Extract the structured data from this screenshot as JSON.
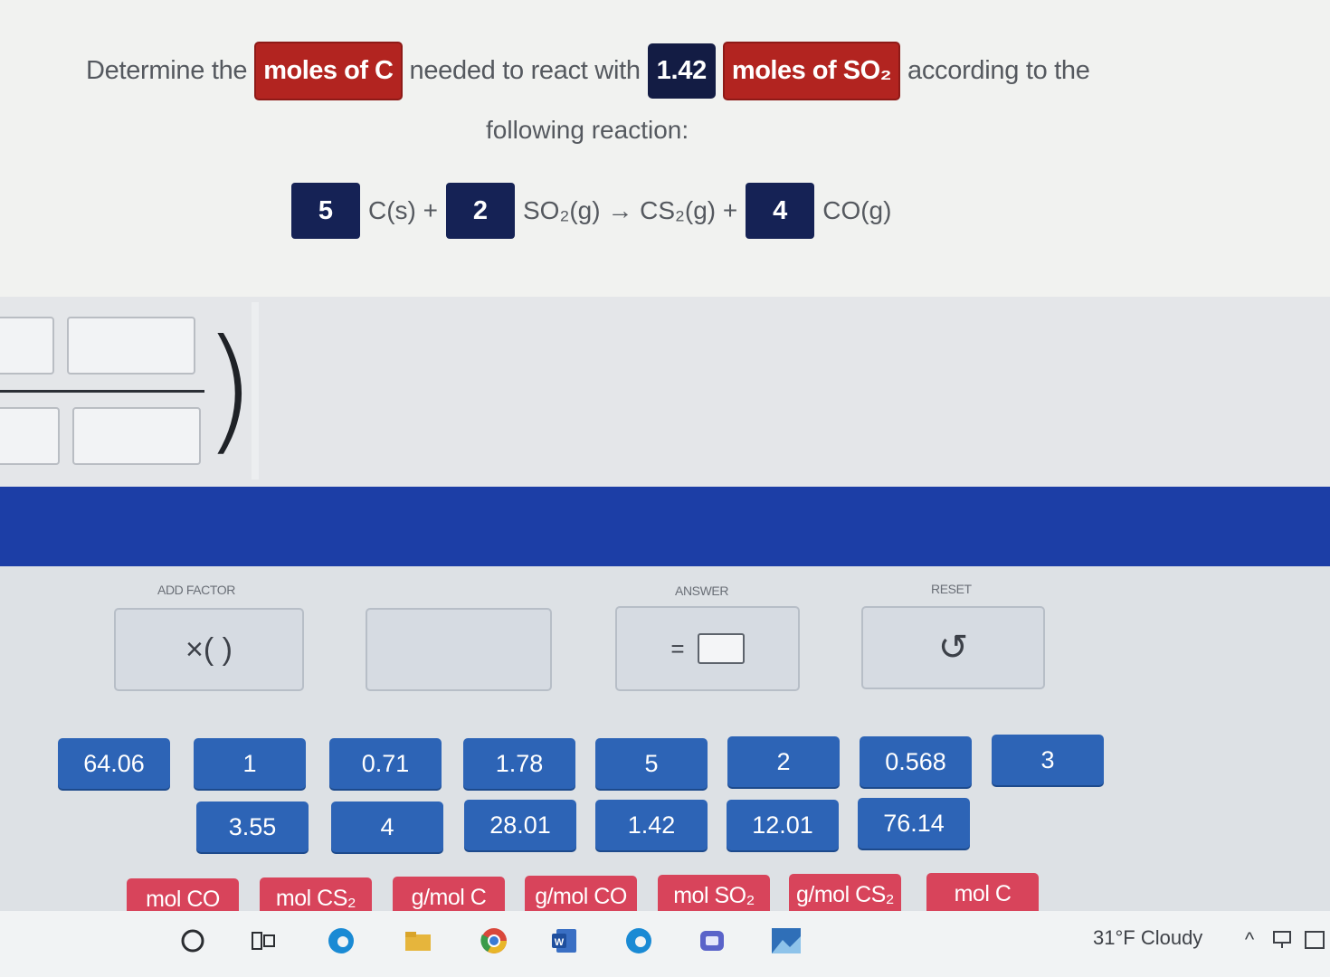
{
  "question": {
    "prefix": "Determine the",
    "target": "moles of C",
    "middle": "needed to react with",
    "given_value": "1.42",
    "given_unit": "moles of SO₂",
    "suffix": "according to the",
    "line2": "following reaction:"
  },
  "reaction": {
    "coef1": "5",
    "species1": "C(s) +",
    "coef2": "2",
    "species2": "SO₂(g) → CS₂(g) +",
    "coef3": "4",
    "species3": "CO(g)"
  },
  "controls": {
    "add_factor_label": "ADD FACTOR",
    "add_factor_symbol": "×( )",
    "answer_label": "ANSWER",
    "answer_symbol": "=",
    "reset_label": "RESET",
    "reset_symbol": "↺"
  },
  "number_tiles": [
    "64.06",
    "1",
    "0.71",
    "1.78",
    "5",
    "2",
    "0.568",
    "3",
    "3.55",
    "4",
    "28.01",
    "1.42",
    "12.01",
    "76.14"
  ],
  "unit_tiles": [
    "mol CO",
    "mol CS₂",
    "g/mol C",
    "g/mol CO",
    "mol SO₂",
    "g/mol CS₂",
    "mol C"
  ],
  "taskbar": {
    "icons": [
      "search-icon",
      "task-view-icon",
      "edge-icon",
      "file-explorer-icon",
      "chrome-icon",
      "word-icon",
      "edge-icon",
      "teams-icon",
      "photos-icon"
    ],
    "weather": "31°F  Cloudy",
    "accent": "#1c3ea6"
  }
}
